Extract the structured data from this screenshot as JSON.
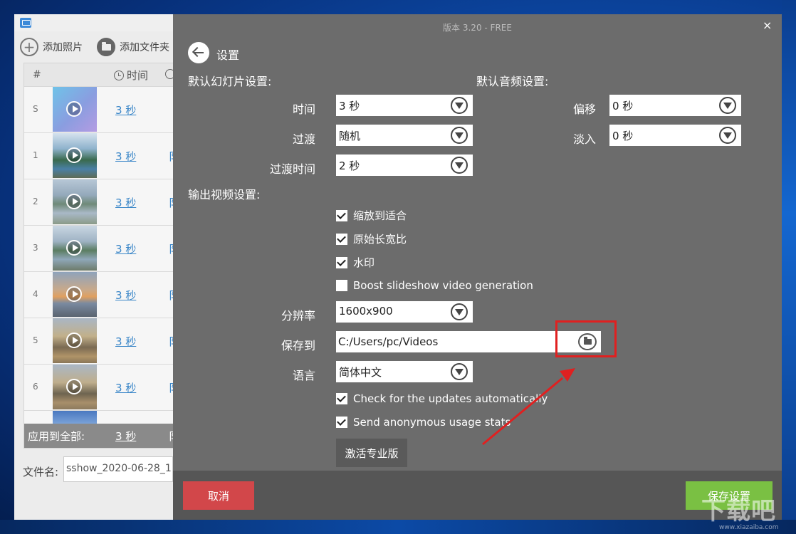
{
  "left_panel": {
    "add_photo_label": "添加照片",
    "add_folder_label": "添加文件夹",
    "col_hash": "#",
    "col_time": "时间",
    "rows": [
      {
        "index": "S",
        "duration": "3 秒"
      },
      {
        "index": "1",
        "duration": "3 秒"
      },
      {
        "index": "2",
        "duration": "3 秒"
      },
      {
        "index": "3",
        "duration": "3 秒"
      },
      {
        "index": "4",
        "duration": "3 秒"
      },
      {
        "index": "5",
        "duration": "3 秒"
      },
      {
        "index": "6",
        "duration": "3 秒"
      }
    ],
    "apply_all_label": "应用到全部:",
    "apply_all_duration": "3 秒",
    "filename_label": "文件名:",
    "filename_value": "sshow_2020-06-28_1"
  },
  "dialog": {
    "title": "版本 3.20 - FREE",
    "close_glyph": "×",
    "page_title": "设置",
    "slideshow_section": "默认幻灯片设置:",
    "audio_section": "默认音频设置:",
    "output_section": "输出视频设置:",
    "time_label": "时间",
    "time_value": "3 秒",
    "transition_label": "过渡",
    "transition_value": "随机",
    "transition_time_label": "过渡时间",
    "transition_time_value": "2 秒",
    "offset_label": "偏移",
    "offset_value": "0 秒",
    "fadein_label": "淡入",
    "fadein_value": "0 秒",
    "checkboxes": [
      {
        "label": "缩放到适合",
        "checked": true
      },
      {
        "label": "原始长宽比",
        "checked": true
      },
      {
        "label": "水印",
        "checked": true
      },
      {
        "label": "Boost slideshow video generation",
        "checked": false
      }
    ],
    "resolution_label": "分辨率",
    "resolution_value": "1600x900",
    "save_to_label": "保存到",
    "save_to_value": "C:/Users/pc/Videos",
    "language_label": "语言",
    "language_value": "简体中文",
    "update_check_label": "Check for the updates automatically",
    "usage_stats_label": "Send anonymous usage stats",
    "activate_label": "激活专业版",
    "cancel_label": "取消",
    "save_label": "保存设置"
  },
  "watermark": {
    "text": "下载吧",
    "sub": "www.xiazaiba.com"
  },
  "colors": {
    "dialog_bg": "#6c6c6c",
    "cancel": "#d2474a",
    "save": "#7ac043",
    "highlight": "#e02020",
    "link": "#3a86c8"
  }
}
